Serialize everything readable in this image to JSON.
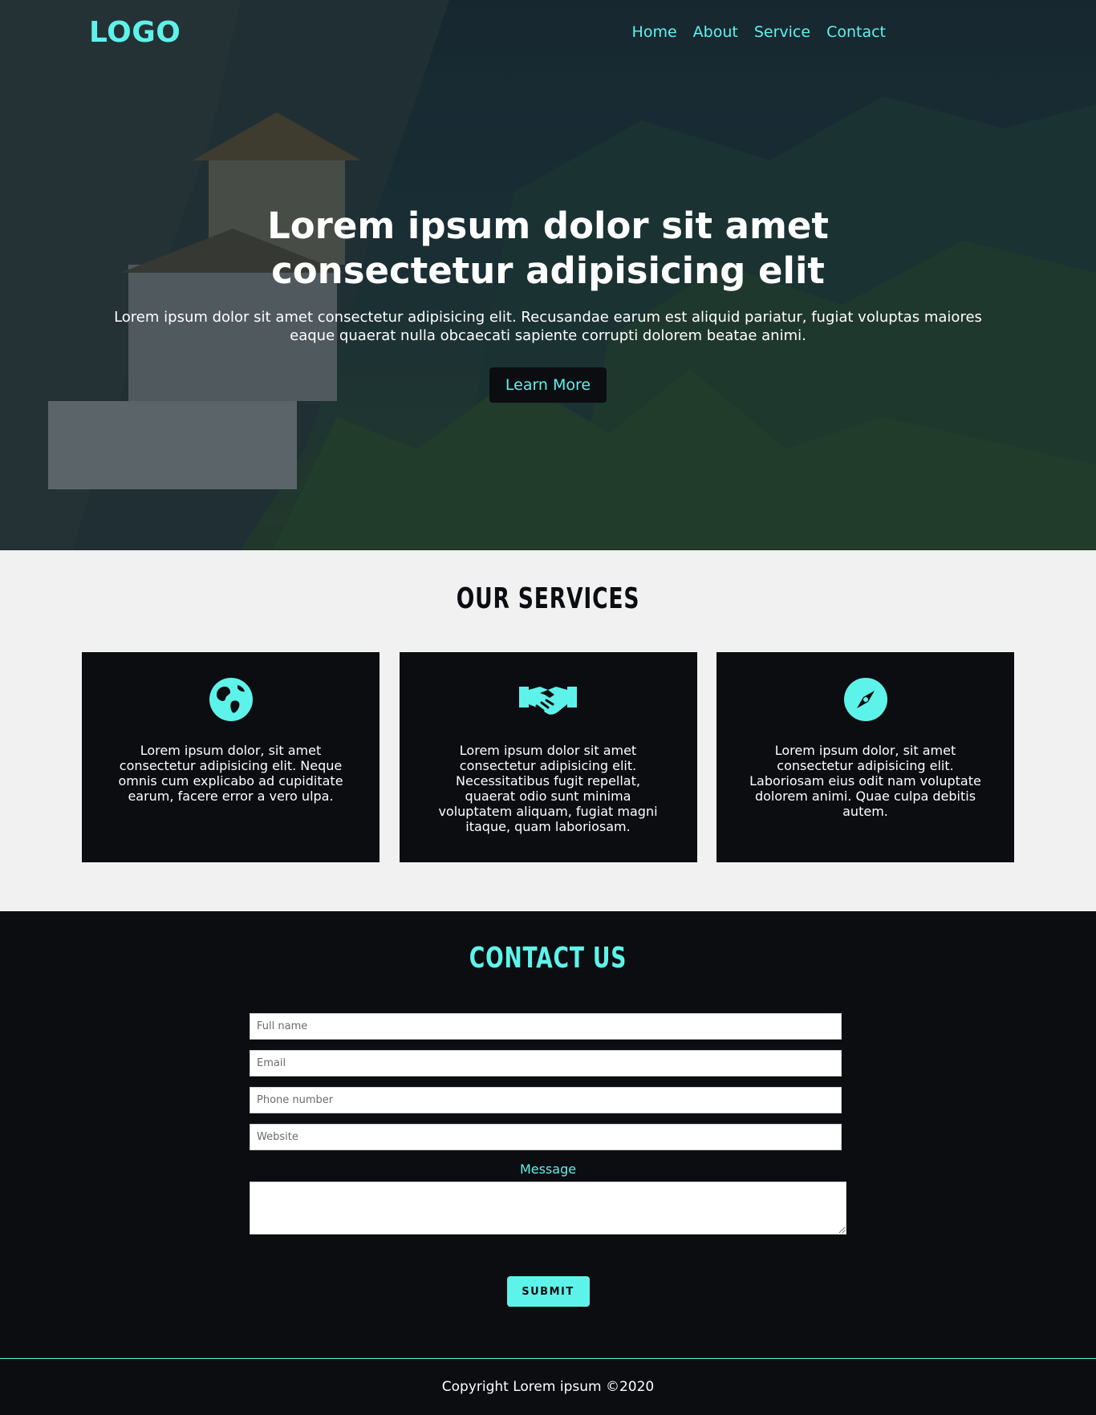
{
  "colors": {
    "accent": "#5ef3ea",
    "dark": "#0b0d11",
    "light_section": "#f1f1f1",
    "text_on_dark": "#ffffff"
  },
  "header": {
    "logo": "LOGO",
    "nav": [
      {
        "label": "Home"
      },
      {
        "label": "About"
      },
      {
        "label": "Service"
      },
      {
        "label": "Contact"
      }
    ]
  },
  "hero": {
    "title": "Lorem ipsum dolor sit amet consectetur adipisicing elit",
    "text": "Lorem ipsum dolor sit amet consectetur adipisicing elit. Recusandae earum est aliquid pariatur, fugiat voluptas maiores eaque quaerat nulla obcaecati sapiente corrupti dolorem beatae animi.",
    "button_label": "Learn More"
  },
  "services": {
    "title": "OUR SERVICES",
    "cards": [
      {
        "icon": "globe-icon",
        "text": "Lorem ipsum dolor, sit amet consectetur adipisicing elit. Neque omnis cum explicabo ad cupiditate earum, facere error a vero ulpa."
      },
      {
        "icon": "handshake-icon",
        "text": "Lorem ipsum dolor sit amet consectetur adipisicing elit. Necessitatibus fugit repellat, quaerat odio sunt minima voluptatem aliquam, fugiat magni itaque, quam laboriosam."
      },
      {
        "icon": "compass-icon",
        "text": "Lorem ipsum dolor, sit amet consectetur adipisicing elit. Laboriosam eius odit nam voluptate dolorem animi. Quae culpa debitis autem."
      }
    ]
  },
  "contact": {
    "title": "CONTACT US",
    "fields": {
      "full_name": {
        "placeholder": "Full name",
        "value": ""
      },
      "email": {
        "placeholder": "Email",
        "value": ""
      },
      "phone": {
        "placeholder": "Phone number",
        "value": ""
      },
      "website": {
        "placeholder": "Website",
        "value": ""
      }
    },
    "message_label": "Message",
    "submit_label": "SUBMIT"
  },
  "footer": {
    "copyright": "Copyright Lorem ipsum ©2020"
  }
}
